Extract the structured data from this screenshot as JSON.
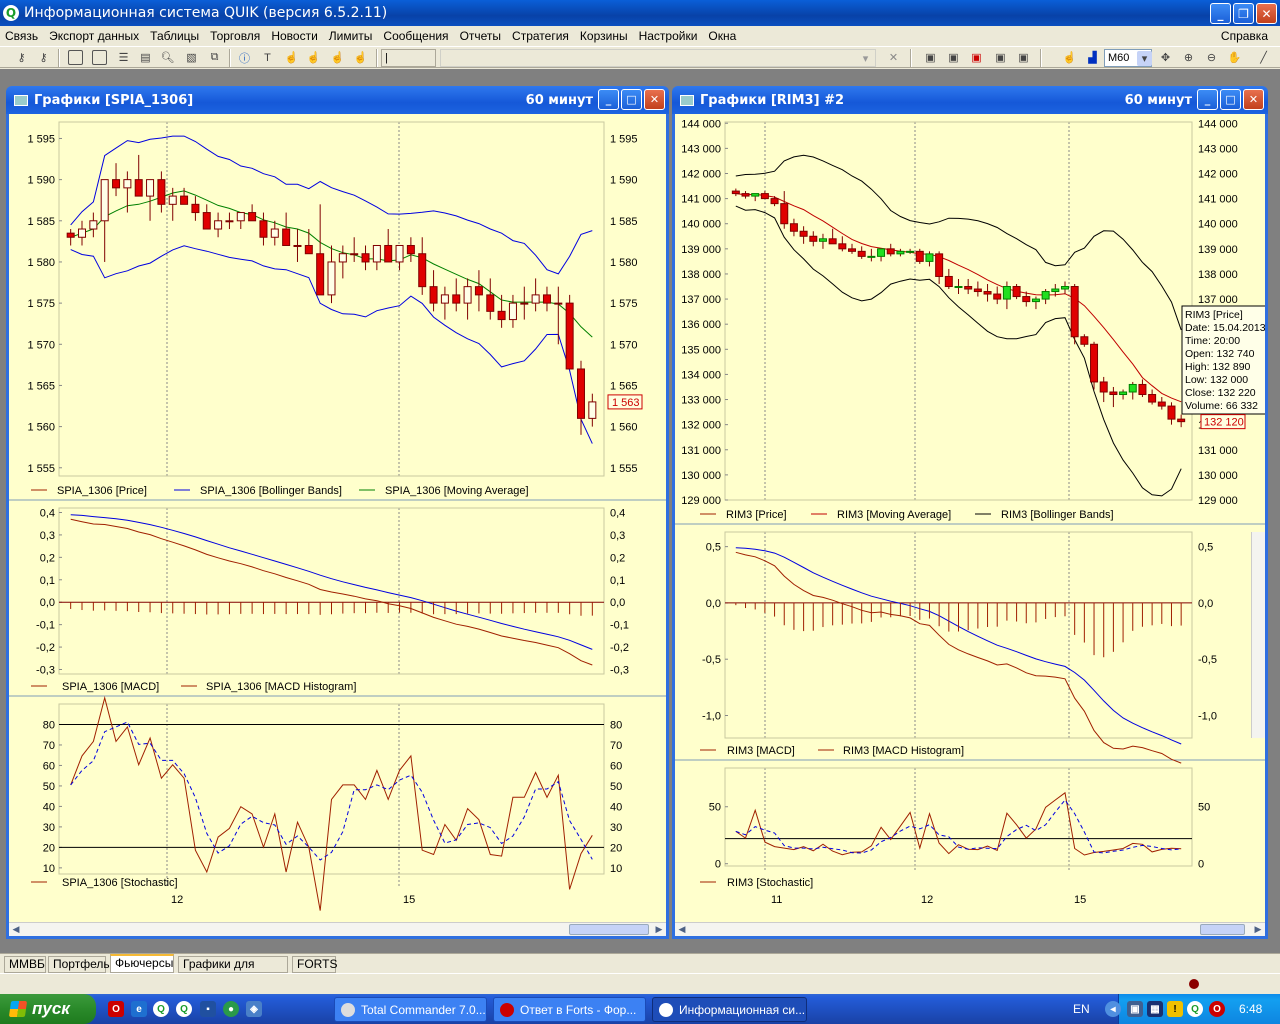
{
  "app": {
    "title": "Информационная система QUIK (версия 6.5.2.11)"
  },
  "menu": {
    "items": [
      "Связь",
      "Экспорт данных",
      "Таблицы",
      "Торговля",
      "Новости",
      "Лимиты",
      "Сообщения",
      "Отчеты",
      "Стратегия",
      "Корзины",
      "Настройки",
      "Окна"
    ],
    "help": "Справка"
  },
  "toolbar": {
    "combo_text": "|",
    "interval": "M60"
  },
  "left_window": {
    "title": "Графики [SPIA_1306]",
    "timeframe": "60 минут",
    "price_axis": [
      "1 595",
      "1 590",
      "1 585",
      "1 580",
      "1 575",
      "1 570",
      "1 565",
      "1 560",
      "1 555"
    ],
    "last_price": "1 563",
    "price_legend": [
      "SPIA_1306 [Price]",
      "SPIA_1306 [Bollinger Bands]",
      "SPIA_1306 [Moving Average]"
    ],
    "macd_axis": [
      "0,4",
      "0,3",
      "0,2",
      "0,1",
      "0,0",
      "-0,1",
      "-0,2",
      "-0,3"
    ],
    "macd_legend": [
      "SPIA_1306 [MACD]",
      "SPIA_1306 [MACD Histogram]"
    ],
    "stoch_axis": [
      "80",
      "70",
      "60",
      "50",
      "40",
      "30",
      "20",
      "10"
    ],
    "stoch_legend": [
      "SPIA_1306 [Stochastic]"
    ],
    "dates": [
      "12",
      "15"
    ]
  },
  "right_window": {
    "title": "Графики [RIM3] #2",
    "timeframe": "60 минут",
    "price_axis": [
      "144 000",
      "143 000",
      "142 000",
      "141 000",
      "140 000",
      "139 000",
      "138 000",
      "137 000",
      "136 000",
      "135 000",
      "134 000",
      "133 000",
      "132 000",
      "131 000",
      "130 000",
      "129 000"
    ],
    "price_axis_right": [
      "144 000",
      "143 000",
      "142 000",
      "141 000",
      "140 000",
      "139 000",
      "138 000",
      "137 000",
      "132 000",
      "131 000",
      "130 000",
      "129 000"
    ],
    "last_price": "132 120",
    "price_legend": [
      "RIM3 [Price]",
      "RIM3 [Moving Average]",
      "RIM3 [Bollinger Bands]"
    ],
    "tooltip": [
      "RIM3 [Price]",
      "Date: 15.04.2013",
      "Time: 20:00",
      "Open:  132 740",
      "High:   132 890",
      "Low:    132 000",
      "Close: 132 220",
      "Volume: 66 332"
    ],
    "macd_axis": [
      "0,5",
      "0,0",
      "-0,5",
      "-1,0"
    ],
    "macd_legend": [
      "RIM3 [MACD]",
      "RIM3 [MACD Histogram]"
    ],
    "stoch_axis": [
      "50",
      "0"
    ],
    "stoch_legend": [
      "RIM3 [Stochastic]"
    ],
    "dates": [
      "11",
      "12",
      "15"
    ]
  },
  "tabs": [
    "ММВБ",
    "Портфель",
    "Фьючерсы",
    "Графики для робота",
    "FORTS"
  ],
  "active_tab": "Фьючерсы",
  "taskbar": {
    "start_label": "пуск",
    "tasks": [
      "Total Commander 7.0...",
      "Ответ в Forts - Фор...",
      "Информационная си..."
    ],
    "lang": "EN",
    "time": "6:48"
  },
  "chart_data": [
    {
      "type": "candlestick",
      "title": "SPIA_1306",
      "ylim": [
        1555,
        1597
      ],
      "series": [
        {
          "name": "SPIA_1306 [Price]",
          "ohlc": [
            [
              1583.5,
              1584,
              1582,
              1583
            ],
            [
              1583,
              1585,
              1582,
              1584
            ],
            [
              1584,
              1586,
              1583,
              1585
            ],
            [
              1585,
              1590,
              1580,
              1590
            ],
            [
              1590,
              1592,
              1588,
              1589
            ],
            [
              1589,
              1591,
              1586,
              1590
            ],
            [
              1590,
              1593,
              1589,
              1588
            ],
            [
              1588,
              1590,
              1585,
              1590
            ],
            [
              1590,
              1591,
              1586,
              1587
            ],
            [
              1587,
              1589,
              1585,
              1588
            ],
            [
              1588,
              1589,
              1587,
              1587
            ],
            [
              1587,
              1588,
              1585,
              1586
            ],
            [
              1586,
              1587,
              1584,
              1584
            ],
            [
              1584,
              1586,
              1583,
              1585
            ],
            [
              1585,
              1586,
              1584,
              1585
            ],
            [
              1585,
              1586,
              1584,
              1586
            ],
            [
              1586,
              1587,
              1585,
              1585
            ],
            [
              1585,
              1586,
              1582,
              1583
            ],
            [
              1583,
              1585,
              1582,
              1584
            ],
            [
              1584,
              1586,
              1582,
              1582
            ],
            [
              1582,
              1584,
              1580,
              1582
            ],
            [
              1582,
              1584,
              1581,
              1581
            ],
            [
              1581,
              1587,
              1578,
              1576
            ],
            [
              1576,
              1582,
              1575,
              1580
            ],
            [
              1580,
              1582,
              1578,
              1581
            ],
            [
              1581,
              1583,
              1580,
              1581
            ],
            [
              1581,
              1582,
              1579,
              1580
            ],
            [
              1580,
              1582,
              1579,
              1582
            ],
            [
              1582,
              1584,
              1580,
              1580
            ],
            [
              1580,
              1582,
              1579,
              1582
            ],
            [
              1582,
              1583,
              1580,
              1581
            ],
            [
              1581,
              1583,
              1576,
              1577
            ],
            [
              1577,
              1579,
              1574,
              1575
            ],
            [
              1575,
              1577,
              1573,
              1576
            ],
            [
              1576,
              1578,
              1574,
              1575
            ],
            [
              1575,
              1578,
              1573,
              1577
            ],
            [
              1577,
              1579,
              1574,
              1576
            ],
            [
              1576,
              1578,
              1573,
              1574
            ],
            [
              1574,
              1576,
              1572,
              1573
            ],
            [
              1573,
              1576,
              1572,
              1575
            ],
            [
              1575,
              1577,
              1573,
              1575
            ],
            [
              1575,
              1578,
              1574,
              1576
            ],
            [
              1576,
              1577,
              1574,
              1575
            ],
            [
              1575,
              1577,
              1570,
              1575
            ],
            [
              1575,
              1576,
              1568,
              1567
            ],
            [
              1567,
              1568,
              1559,
              1561
            ],
            [
              1561,
              1564,
              1560,
              1563
            ]
          ]
        }
      ]
    },
    {
      "type": "candlestick",
      "title": "RIM3",
      "ylim": [
        129000,
        144000
      ],
      "series": [
        {
          "name": "RIM3 [Price]",
          "ohlc": [
            [
              141300,
              141400,
              141100,
              141200
            ],
            [
              141200,
              141300,
              141000,
              141100
            ],
            [
              141100,
              141200,
              140900,
              141200
            ],
            [
              141200,
              141300,
              141000,
              141000
            ],
            [
              141000,
              141100,
              140700,
              140800
            ],
            [
              140800,
              141300,
              139800,
              140000
            ],
            [
              140000,
              140200,
              139500,
              139700
            ],
            [
              139700,
              139900,
              139200,
              139500
            ],
            [
              139500,
              139700,
              139100,
              139300
            ],
            [
              139300,
              139600,
              139000,
              139400
            ],
            [
              139400,
              139800,
              139200,
              139200
            ],
            [
              139200,
              139500,
              138900,
              139000
            ],
            [
              139000,
              139200,
              138800,
              138900
            ],
            [
              138900,
              139100,
              138600,
              138700
            ],
            [
              138700,
              139000,
              138500,
              138700
            ],
            [
              138700,
              139000,
              138500,
              139000
            ],
            [
              139000,
              139200,
              138700,
              138800
            ],
            [
              138800,
              139000,
              138700,
              138900
            ],
            [
              138900,
              139000,
              138800,
              138900
            ],
            [
              138900,
              139000,
              138400,
              138500
            ],
            [
              138500,
              138900,
              138300,
              138800
            ],
            [
              138800,
              138900,
              137600,
              137900
            ],
            [
              137900,
              138200,
              137400,
              137500
            ],
            [
              137500,
              137800,
              137200,
              137500
            ],
            [
              137500,
              137800,
              137200,
              137400
            ],
            [
              137400,
              137700,
              137100,
              137300
            ],
            [
              137300,
              137600,
              136900,
              137200
            ],
            [
              137200,
              137500,
              136800,
              137000
            ],
            [
              137000,
              137700,
              136600,
              137500
            ],
            [
              137500,
              137600,
              137000,
              137100
            ],
            [
              137100,
              137300,
              136700,
              136900
            ],
            [
              136900,
              137100,
              136600,
              137000
            ],
            [
              137000,
              137400,
              136800,
              137300
            ],
            [
              137300,
              137600,
              137100,
              137400
            ],
            [
              137400,
              137700,
              137200,
              137500
            ],
            [
              137500,
              137600,
              135200,
              135500
            ],
            [
              135500,
              135600,
              135100,
              135200
            ],
            [
              135200,
              135300,
              133400,
              133700
            ],
            [
              133700,
              133900,
              132900,
              133300
            ],
            [
              133300,
              133500,
              132700,
              133200
            ],
            [
              133200,
              133400,
              133000,
              133300
            ],
            [
              133300,
              133700,
              133000,
              133600
            ],
            [
              133600,
              133800,
              133100,
              133200
            ],
            [
              133200,
              133400,
              132800,
              132900
            ],
            [
              132900,
              133100,
              132600,
              132740
            ],
            [
              132740,
              132890,
              132000,
              132220
            ],
            [
              132220,
              132400,
              131900,
              132120
            ]
          ]
        }
      ]
    }
  ]
}
